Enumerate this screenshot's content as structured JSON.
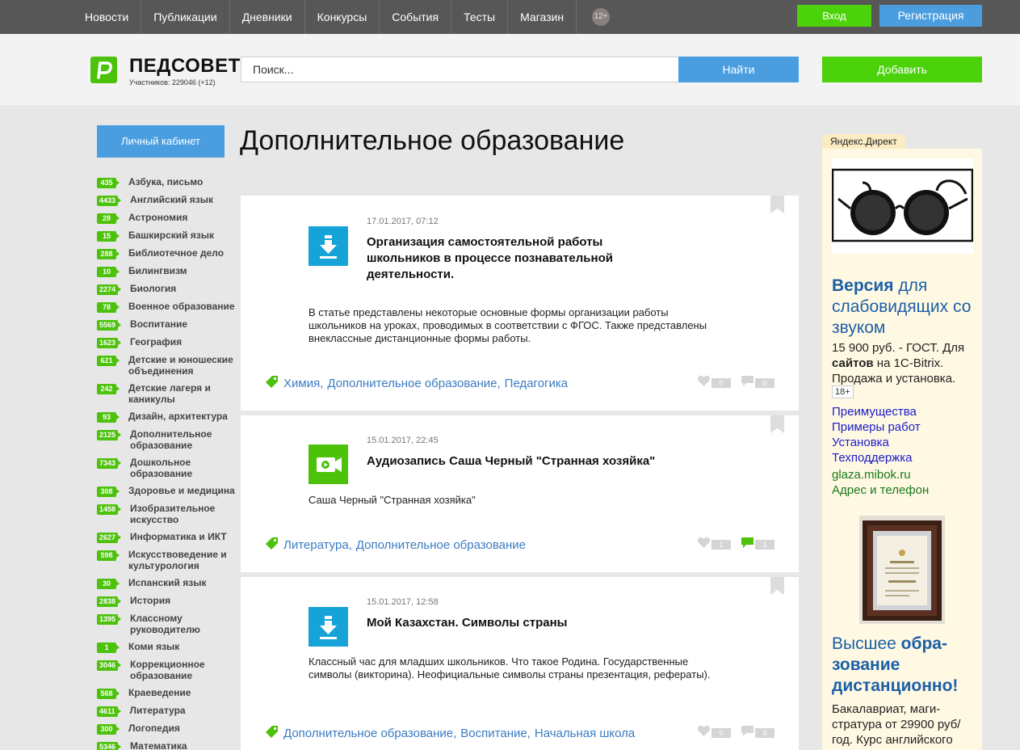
{
  "topnav": {
    "items": [
      "Новости",
      "Публикации",
      "Дневники",
      "Конкурсы",
      "События",
      "Тесты",
      "Магазин"
    ],
    "age": "12+",
    "login": "Вход",
    "register": "Регистрация"
  },
  "header": {
    "logo_name": "ПЕДСОВЕТ",
    "logo_sub": "Участников: 229046 (+12)",
    "search_placeholder": "Поиск...",
    "find": "Найти",
    "add": "Добавить"
  },
  "sidebar": {
    "cabinet": "Личный кабинет",
    "categories": [
      {
        "count": "435",
        "label": "Азбука, письмо"
      },
      {
        "count": "4433",
        "label": "Английский язык"
      },
      {
        "count": "28",
        "label": "Астрономия"
      },
      {
        "count": "15",
        "label": "Башкирский язык"
      },
      {
        "count": "288",
        "label": "Библиотечное дело"
      },
      {
        "count": "10",
        "label": "Билингвизм"
      },
      {
        "count": "2274",
        "label": "Биология"
      },
      {
        "count": "78",
        "label": "Военное образование"
      },
      {
        "count": "5569",
        "label": "Воспитание"
      },
      {
        "count": "1623",
        "label": "География"
      },
      {
        "count": "621",
        "label": "Детские и юношеские объединения"
      },
      {
        "count": "242",
        "label": "Детские лагеря и каникулы"
      },
      {
        "count": "93",
        "label": "Дизайн, архитектура"
      },
      {
        "count": "2125",
        "label": "Дополнительное образование"
      },
      {
        "count": "7343",
        "label": "Дошкольное образование"
      },
      {
        "count": "308",
        "label": "Здоровье и медицина"
      },
      {
        "count": "1458",
        "label": "Изобразительное искусство"
      },
      {
        "count": "2627",
        "label": "Информатика и ИКТ"
      },
      {
        "count": "598",
        "label": "Искусствоведение и культурология"
      },
      {
        "count": "30",
        "label": "Испанский язык"
      },
      {
        "count": "2838",
        "label": "История"
      },
      {
        "count": "1395",
        "label": "Классному руководителю"
      },
      {
        "count": "1",
        "label": "Коми язык"
      },
      {
        "count": "3046",
        "label": "Коррекционное образование"
      },
      {
        "count": "568",
        "label": "Краеведение"
      },
      {
        "count": "4611",
        "label": "Литература"
      },
      {
        "count": "300",
        "label": "Логопедия"
      },
      {
        "count": "5346",
        "label": "Математика"
      }
    ]
  },
  "main": {
    "title": "Дополнительное образование",
    "posts": [
      {
        "date": "17.01.2017, 07:12",
        "type": "download-icon",
        "title": "Организация самостоятельной работы школьников в процессе познавательной деятельности.",
        "desc": "В статье представлены некоторые основные формы организации работы школьников на уроках, проводимых в соответствии с ФГОС. Также представлены внеклассные дистанционные формы работы.",
        "tags": [
          "Химия",
          "Дополнительное образование",
          "Педагогика"
        ],
        "likes": "0",
        "comments": "0"
      },
      {
        "date": "15.01.2017, 22:45",
        "type": "video-icon",
        "title": "Аудиозапись Саша Черный \"Странная хозяйка\"",
        "desc": "Саша Черный \"Странная хозяйка\"",
        "tags": [
          "Литература",
          "Дополнительное образование"
        ],
        "likes": "1",
        "comments": "1"
      },
      {
        "date": "15.01.2017, 12:58",
        "type": "download-icon",
        "title": "Мой Казахстан. Символы страны",
        "desc": "Классный час для младших школьников. Что такое Родина. Государственные символы (викторина). Неофициальные символы страны презентация, рефераты).",
        "tags": [
          "Дополнительное образование",
          "Воспитание",
          "Начальная школа"
        ],
        "likes": "0",
        "comments": "0"
      }
    ]
  },
  "ad": {
    "label": "Яндекс.Директ",
    "head1_bold": "Версия",
    "head1_rest": " для слабовидящих со звуком",
    "text1_pre": "15 900 руб. - ГОСТ. Для ",
    "text1_bold": "сайтов",
    "text1_post": " на 1С-Bitrix. Продажа и установка.",
    "age": "18+",
    "links": [
      "Преимущества",
      "Примеры работ",
      "Установка",
      "Техподдержка"
    ],
    "domain": "glaza.mibok.ru",
    "contact": "Адрес и телефон",
    "head2_a": "Высшее ",
    "head2_b": "обра-зование дистанционно!",
    "text2": "Бакалавриат, маги-стратура от 29900 руб/год. Курс английского"
  },
  "colors": {
    "brand_green": "#4cc20a",
    "accent_blue": "#4a9ee0",
    "link": "#3a7cc2"
  }
}
